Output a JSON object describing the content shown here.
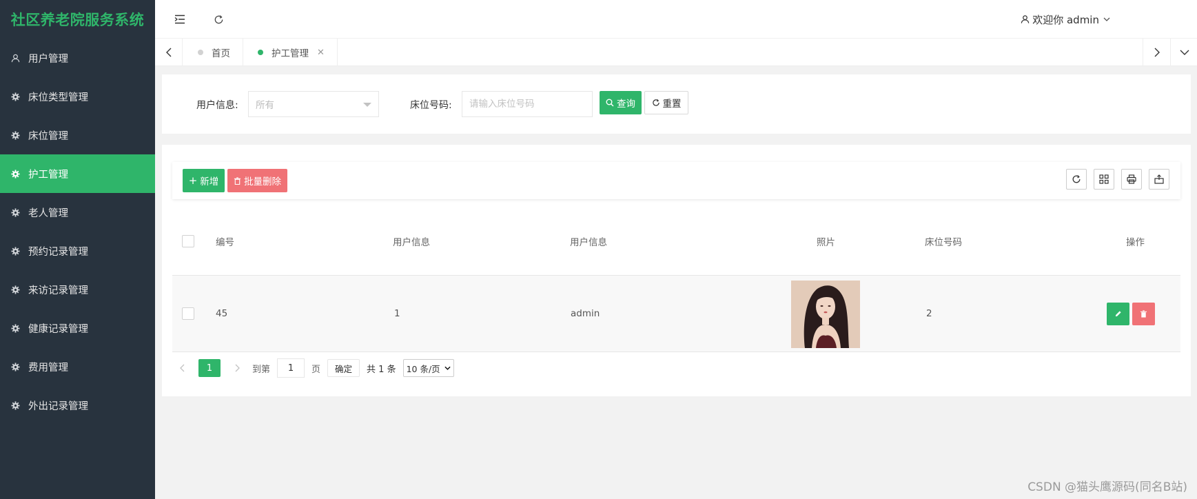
{
  "app": {
    "title": "社区养老院服务系统"
  },
  "sidebar": {
    "items": [
      {
        "label": "用户管理",
        "icon": "user-icon",
        "active": false
      },
      {
        "label": "床位类型管理",
        "icon": "gear-icon",
        "active": false
      },
      {
        "label": "床位管理",
        "icon": "gear-icon",
        "active": false
      },
      {
        "label": "护工管理",
        "icon": "gear-icon",
        "active": true
      },
      {
        "label": "老人管理",
        "icon": "gear-icon",
        "active": false
      },
      {
        "label": "预约记录管理",
        "icon": "gear-icon",
        "active": false
      },
      {
        "label": "来访记录管理",
        "icon": "gear-icon",
        "active": false
      },
      {
        "label": "健康记录管理",
        "icon": "gear-icon",
        "active": false
      },
      {
        "label": "费用管理",
        "icon": "gear-icon",
        "active": false
      },
      {
        "label": "外出记录管理",
        "icon": "gear-icon",
        "active": false
      }
    ]
  },
  "header": {
    "welcome": "欢迎你 admin"
  },
  "tabs": [
    {
      "label": "首页",
      "active": false
    },
    {
      "label": "护工管理",
      "active": true,
      "closable": true
    }
  ],
  "search": {
    "user_label": "用户信息:",
    "user_select_value": "所有",
    "bed_label": "床位号码:",
    "bed_placeholder": "请输入床位号码",
    "query_label": "查询",
    "reset_label": "重置"
  },
  "toolbar": {
    "add_label": "新增",
    "batch_delete_label": "批量删除"
  },
  "table": {
    "columns": [
      "编号",
      "用户信息",
      "用户信息",
      "照片",
      "床位号码",
      "操作"
    ],
    "rows": [
      {
        "id": "45",
        "user_id": "1",
        "user_name": "admin",
        "bed_no": "2"
      }
    ]
  },
  "pagination": {
    "current_page": "1",
    "goto_label": "到第",
    "goto_value": "1",
    "page_unit": "页",
    "confirm_label": "确定",
    "total": "共 1 条",
    "page_size": "10 条/页"
  },
  "watermark": "CSDN @猫头鹰源码(同名B站)",
  "colors": {
    "accent": "#2fb56a",
    "danger": "#f07276",
    "sidebar_bg": "#28333e"
  }
}
